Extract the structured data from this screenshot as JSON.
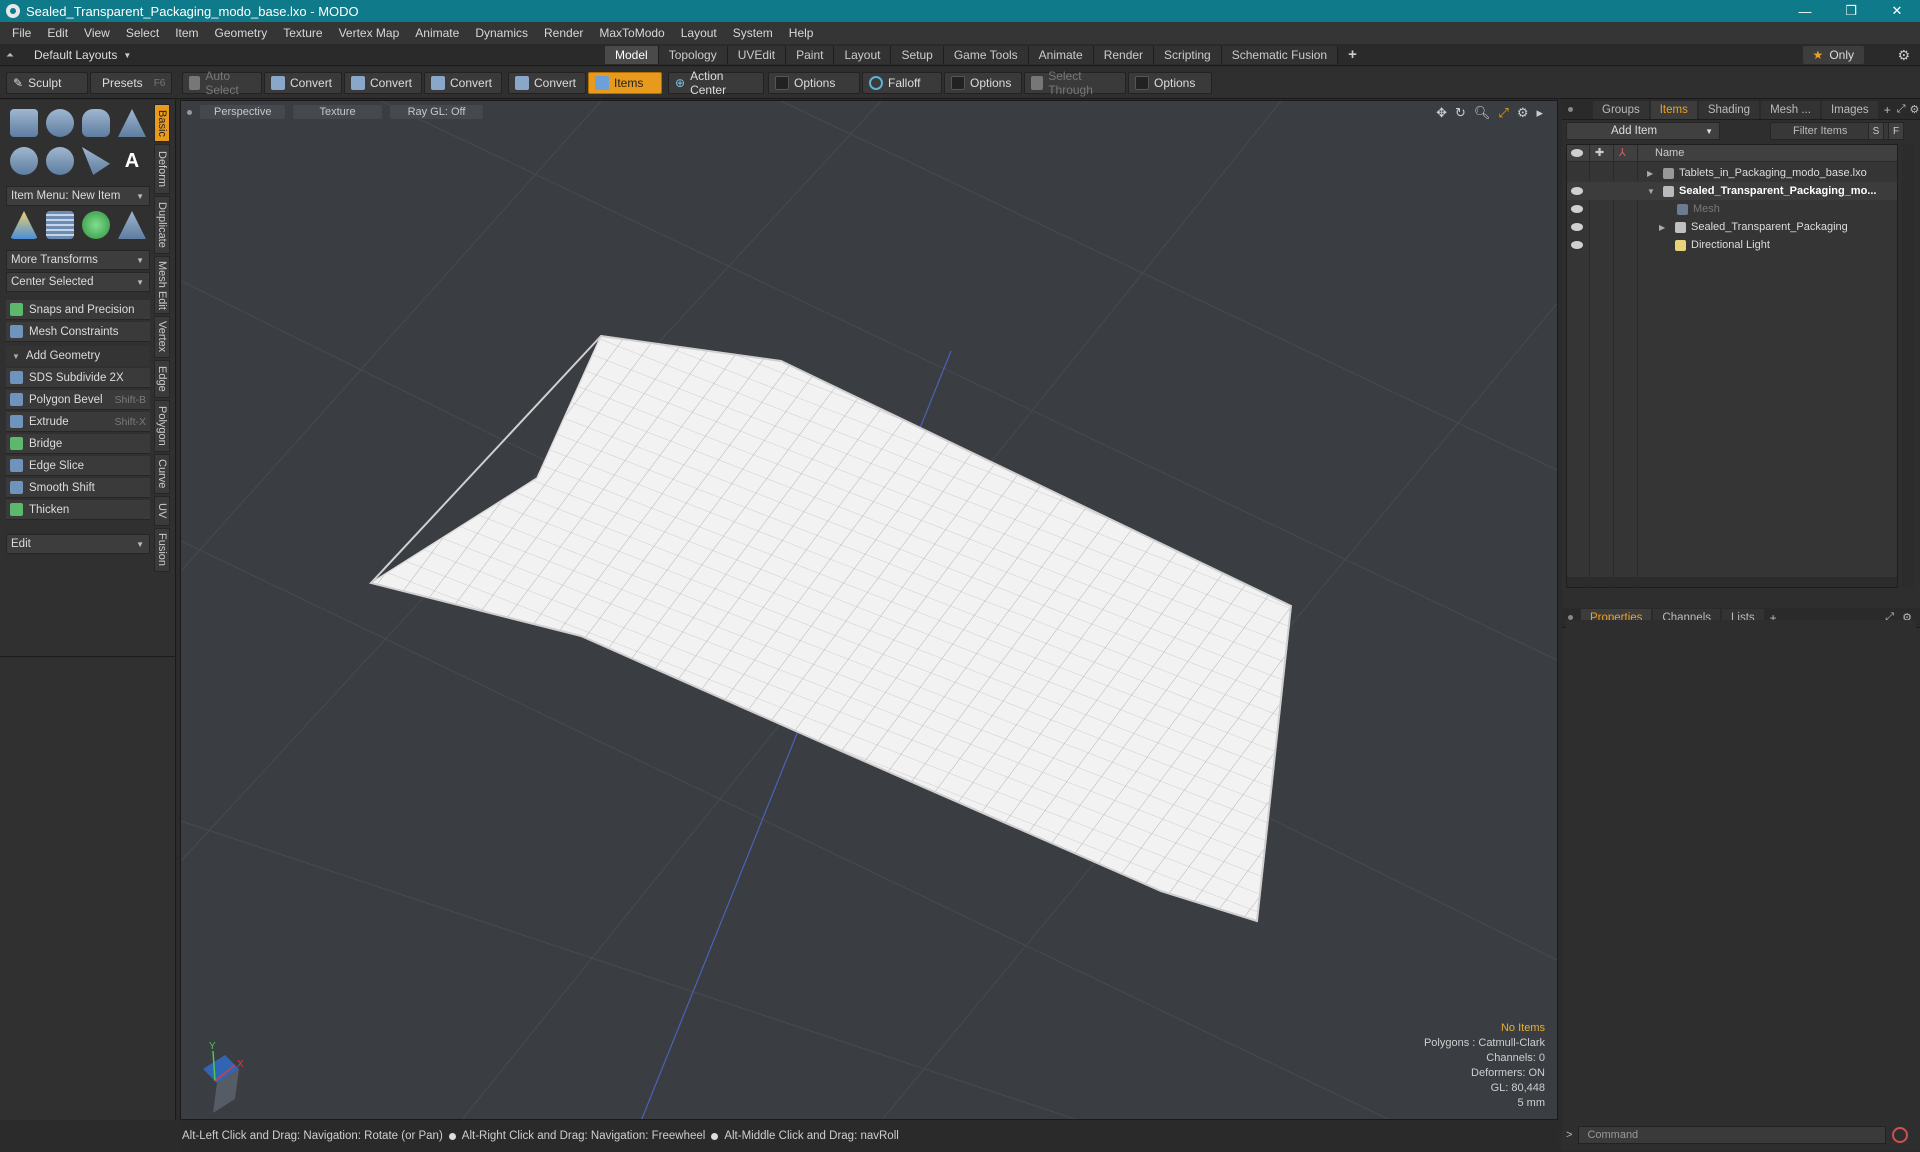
{
  "window": {
    "title": "Sealed_Transparent_Packaging_modo_base.lxo - MODO",
    "controls": [
      "—",
      "❐",
      "✕"
    ]
  },
  "menu": [
    "File",
    "Edit",
    "View",
    "Select",
    "Item",
    "Geometry",
    "Texture",
    "Vertex Map",
    "Animate",
    "Dynamics",
    "Render",
    "MaxToModo",
    "Layout",
    "System",
    "Help"
  ],
  "layout_bar": {
    "layouts_label": "Default Layouts",
    "tabs": [
      "Model",
      "Topology",
      "UVEdit",
      "Paint",
      "Layout",
      "Setup",
      "Game Tools",
      "Animate",
      "Render",
      "Scripting",
      "Schematic Fusion"
    ],
    "active_tab": "Model",
    "add": "+",
    "only_label": "Only"
  },
  "toolbar": {
    "sculpt": "Sculpt",
    "presets": "Presets",
    "presets_shortcut": "F6",
    "auto_select": "Auto Select",
    "convert1": "Convert",
    "convert2": "Convert",
    "convert3": "Convert",
    "convert4": "Convert",
    "items": "Items",
    "action_center": "Action Center",
    "options1": "Options",
    "falloff": "Falloff",
    "options2": "Options",
    "select_through": "Select Through",
    "options3": "Options"
  },
  "left_panel": {
    "item_menu": "Item Menu: New Item",
    "more_transforms": "More Transforms",
    "center_selected": "Center Selected",
    "snaps": "Snaps and Precision",
    "mesh_constraints": "Mesh Constraints",
    "add_geometry": "Add Geometry",
    "tools": [
      {
        "label": "SDS Subdivide 2X",
        "shortcut": ""
      },
      {
        "label": "Polygon Bevel",
        "shortcut": "Shift-B"
      },
      {
        "label": "Extrude",
        "shortcut": "Shift-X"
      },
      {
        "label": "Bridge",
        "shortcut": ""
      },
      {
        "label": "Edge Slice",
        "shortcut": ""
      },
      {
        "label": "Smooth Shift",
        "shortcut": ""
      },
      {
        "label": "Thicken",
        "shortcut": ""
      }
    ],
    "edit": "Edit",
    "vtabs": [
      "Basic",
      "Deform",
      "Duplicate",
      "Mesh Edit",
      "Vertex",
      "Edge",
      "Polygon",
      "Curve",
      "UV",
      "Fusion"
    ]
  },
  "viewport": {
    "view": "Perspective",
    "shading": "Texture",
    "raygl": "Ray GL: Off",
    "stats": {
      "no_items": "No Items",
      "polygons": "Polygons : Catmull-Clark",
      "channels": "Channels: 0",
      "deformers": "Deformers: ON",
      "gl": "GL: 80,448",
      "scale": "5 mm"
    },
    "axis_labels": {
      "x": "X",
      "y": "Y"
    }
  },
  "status": {
    "hint1": "Alt-Left Click and Drag: Navigation: Rotate (or Pan)",
    "hint2": "Alt-Right Click and Drag: Navigation: Freewheel",
    "hint3": "Alt-Middle Click and Drag: navRoll"
  },
  "right_panel": {
    "tabs": [
      "Groups",
      "Items",
      "Shading",
      "Mesh ...",
      "Images"
    ],
    "active_tab": "Items",
    "add_item": "Add Item",
    "filter_items": "Filter Items",
    "s_btn": "S",
    "f_btn": "F",
    "name_col": "Name",
    "items": [
      {
        "label": "Tablets_in_Packaging_modo_base.lxo",
        "depth": 0,
        "expander": "▶",
        "eye": false,
        "bold": false,
        "muted": false
      },
      {
        "label": "Sealed_Transparent_Packaging_mo...",
        "depth": 0,
        "expander": "▼",
        "eye": true,
        "bold": true,
        "muted": false
      },
      {
        "label": "Mesh",
        "depth": 1,
        "expander": "",
        "eye": true,
        "bold": false,
        "muted": true
      },
      {
        "label": "Sealed_Transparent_Packaging",
        "depth": 1,
        "expander": "▶",
        "eye": true,
        "bold": false,
        "muted": false
      },
      {
        "label": "Directional Light",
        "depth": 1,
        "expander": "",
        "eye": true,
        "bold": false,
        "muted": false
      }
    ],
    "bottom_tabs": [
      "Properties",
      "Channels",
      "Lists"
    ],
    "bottom_active": "Properties",
    "command_placeholder": "Command"
  }
}
